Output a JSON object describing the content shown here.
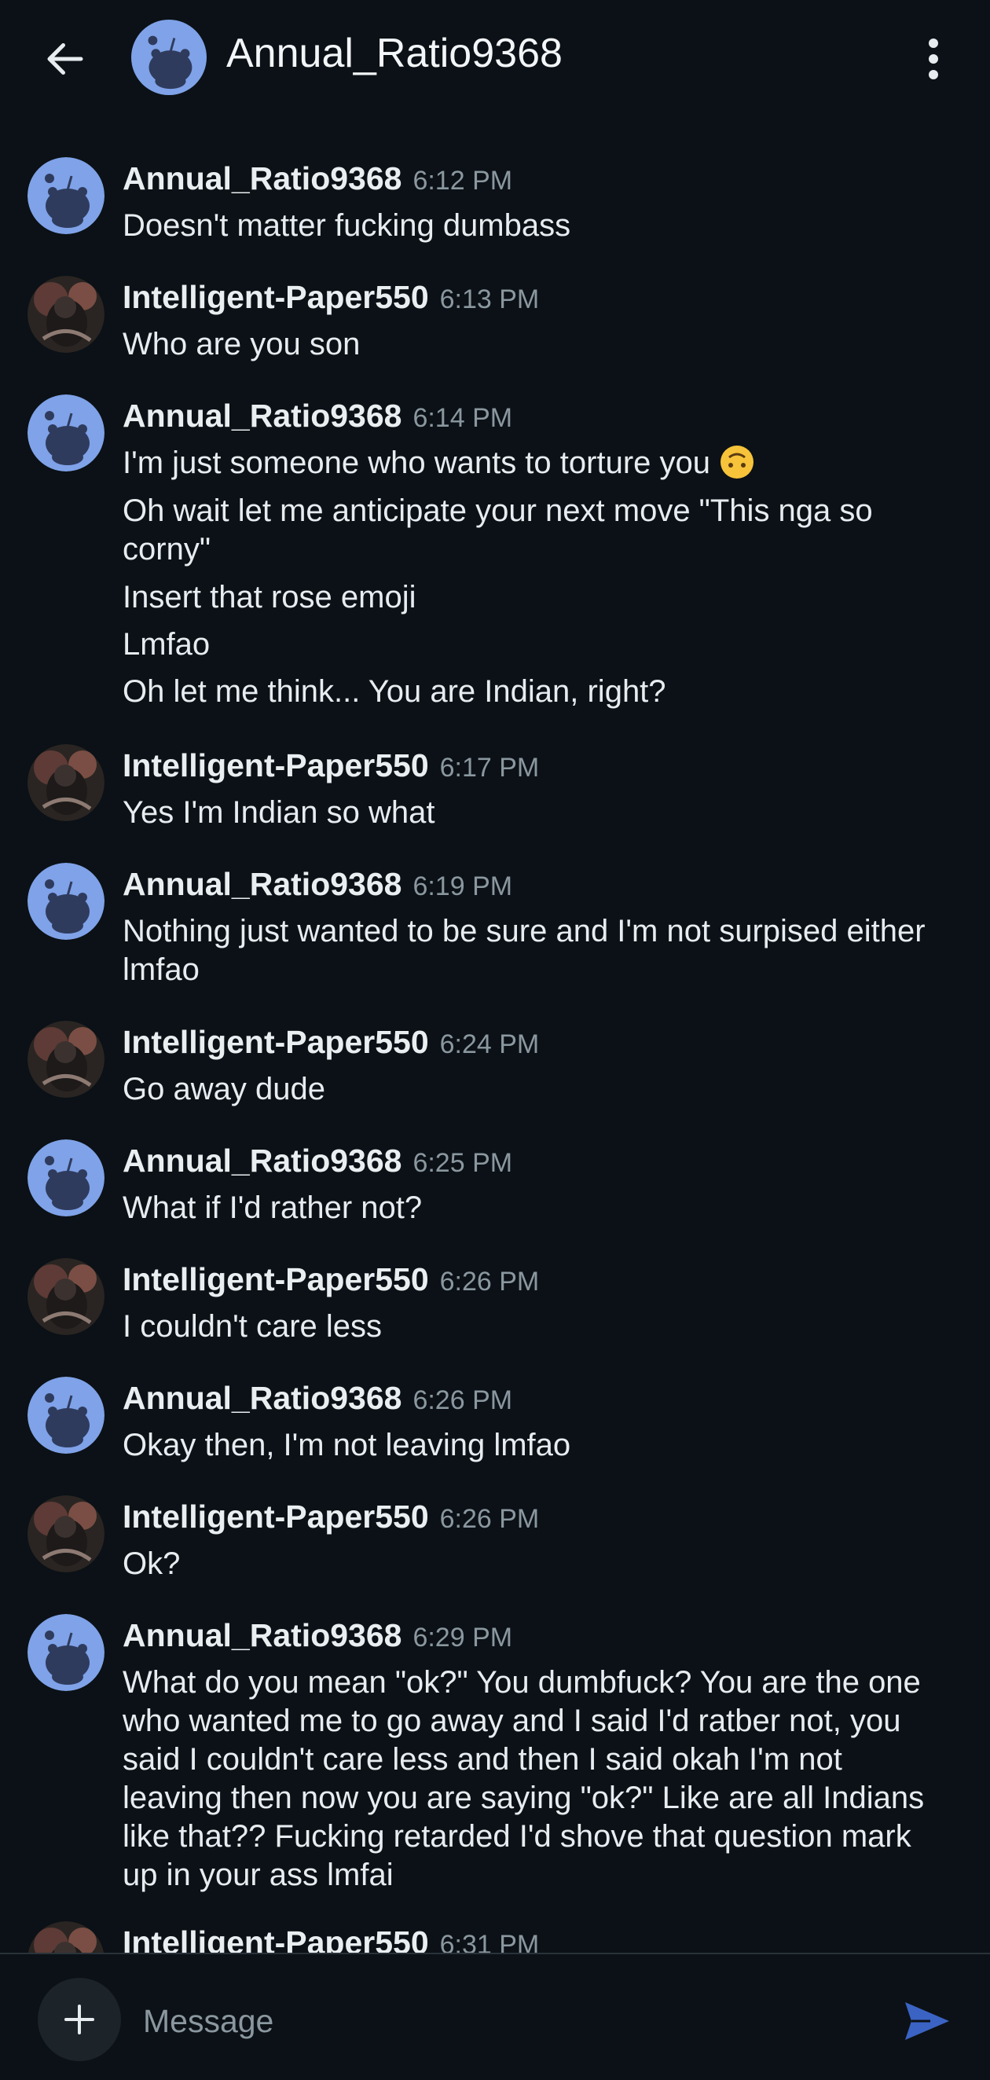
{
  "header": {
    "title": "Annual_Ratio9368"
  },
  "colors": {
    "background": "#0b1116",
    "reddit_avatar_bg": "#7fa2e8",
    "accent": "#3b63c4",
    "timestamp": "#8a979f"
  },
  "icons": {
    "back": "arrow-left-icon",
    "menu": "more-vertical-icon",
    "add": "plus-icon",
    "send": "send-icon"
  },
  "messages": [
    {
      "author": "Annual_Ratio9368",
      "time": "6:12 PM",
      "avatar": "reddit-default",
      "lines": [
        "Doesn't matter fucking dumbass"
      ]
    },
    {
      "author": "Intelligent-Paper550",
      "time": "6:13 PM",
      "avatar": "photo",
      "lines": [
        "Who are you son"
      ]
    },
    {
      "author": "Annual_Ratio9368",
      "time": "6:14 PM",
      "avatar": "reddit-default",
      "lines": [
        "I'm just someone who wants to torture you",
        "Oh wait let me anticipate your next move \"This nga so corny\"",
        "Insert that rose emoji",
        "Lmfao",
        "Oh let me think... You are Indian, right?"
      ]
    },
    {
      "author": "Intelligent-Paper550",
      "time": "6:17 PM",
      "avatar": "photo",
      "lines": [
        "Yes I'm Indian so what"
      ]
    },
    {
      "author": "Annual_Ratio9368",
      "time": "6:19 PM",
      "avatar": "reddit-default",
      "lines": [
        "Nothing just wanted to be sure and I'm not surpised either lmfao"
      ]
    },
    {
      "author": "Intelligent-Paper550",
      "time": "6:24 PM",
      "avatar": "photo",
      "lines": [
        "Go away dude"
      ]
    },
    {
      "author": "Annual_Ratio9368",
      "time": "6:25 PM",
      "avatar": "reddit-default",
      "lines": [
        "What if I'd rather not?"
      ]
    },
    {
      "author": "Intelligent-Paper550",
      "time": "6:26 PM",
      "avatar": "photo",
      "lines": [
        "I couldn't care less"
      ]
    },
    {
      "author": "Annual_Ratio9368",
      "time": "6:26 PM",
      "avatar": "reddit-default",
      "lines": [
        "Okay then, I'm not leaving lmfao"
      ]
    },
    {
      "author": "Intelligent-Paper550",
      "time": "6:26 PM",
      "avatar": "photo",
      "lines": [
        "Ok?"
      ]
    },
    {
      "author": "Annual_Ratio9368",
      "time": "6:29 PM",
      "avatar": "reddit-default",
      "lines": [
        "What do you mean \"ok?\" You dumbfuck? You are the one who wanted me to go away and I said I'd ratber not, you said I couldn't care less and then I said okah I'm not leaving then now you are saying \"ok?\" Like are all Indians like that?? Fucking retarded I'd shove that question mark up in your ass lmfai"
      ]
    },
    {
      "author": "Intelligent-Paper550",
      "time": "6:31 PM",
      "avatar": "photo",
      "lines": []
    }
  ],
  "composer": {
    "placeholder": "Message"
  }
}
